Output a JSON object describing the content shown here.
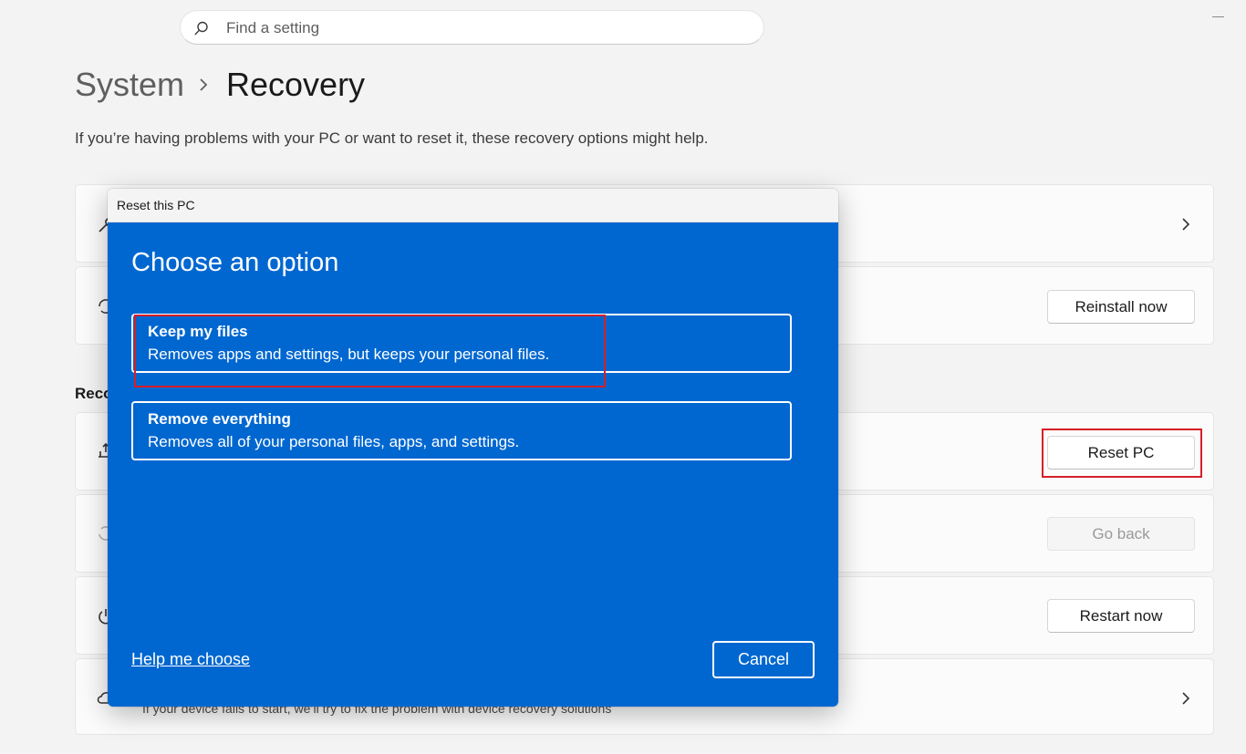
{
  "search": {
    "placeholder": "Find a setting"
  },
  "breadcrumb": {
    "parent": "System",
    "current": "Recovery"
  },
  "description": "If you’re having problems with your PC or want to reset it, these recovery options might help.",
  "buttons": {
    "reinstall_now": "Reinstall now",
    "reset_pc": "Reset PC",
    "go_back": "Go back",
    "restart_now": "Restart now"
  },
  "section": {
    "label_partial": "Reco"
  },
  "bottom_card": {
    "text": "If your device fails to start, we’ll try to fix the problem with device recovery solutions"
  },
  "dialog": {
    "title": "Reset this PC",
    "heading": "Choose an option",
    "options": [
      {
        "title": "Keep my files",
        "subtitle": "Removes apps and settings, but keeps your personal files."
      },
      {
        "title": "Remove everything",
        "subtitle": "Removes all of your personal files, apps, and settings."
      }
    ],
    "help_link": "Help me choose",
    "cancel": "Cancel"
  },
  "colors": {
    "dialog_blue": "#0067d0",
    "highlight_red": "#d61f26",
    "page_bg": "#f3f3f3"
  },
  "icons": [
    "search-icon",
    "chevron-right-icon",
    "wrench-icon",
    "sync-icon",
    "reset-pc-icon",
    "go-back-icon",
    "power-icon",
    "cloud-icon",
    "minimize-icon"
  ]
}
